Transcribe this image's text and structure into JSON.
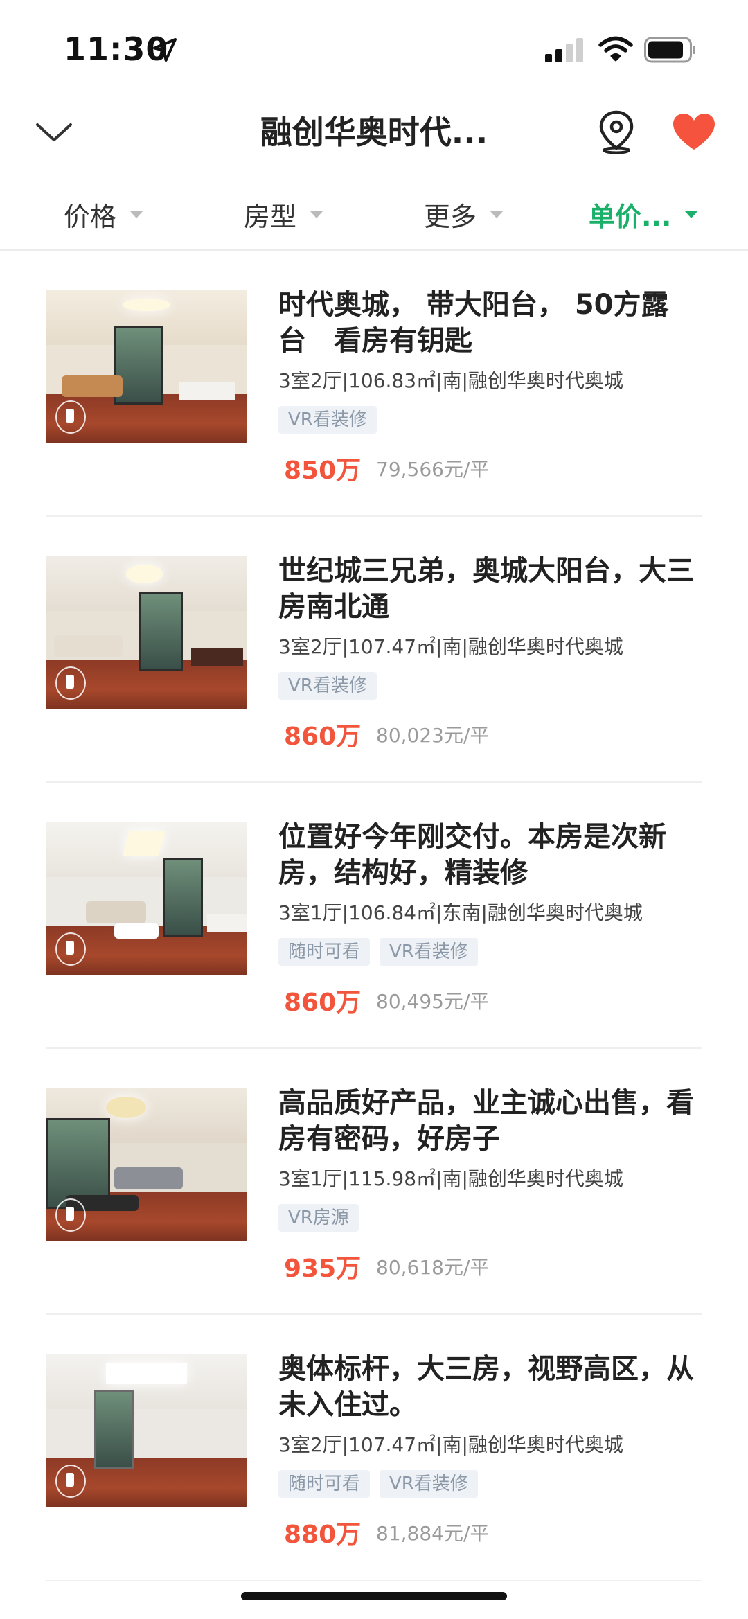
{
  "status_bar": {
    "time": "11:30"
  },
  "nav": {
    "title": "融创华奥时代..."
  },
  "filters": [
    {
      "label": "价格",
      "active": false
    },
    {
      "label": "房型",
      "active": false
    },
    {
      "label": "更多",
      "active": false
    },
    {
      "label": "单价...",
      "active": true
    }
  ],
  "listings": [
    {
      "title": "时代奥城， 带大阳台， 50方露台　看房有钥匙",
      "meta": "3室2厅|106.83㎡|南|融创华奥时代奥城",
      "tags": [
        "VR看装修"
      ],
      "price": "850万",
      "unit_price": "79,566元/平"
    },
    {
      "title": "世纪城三兄弟，奥城大阳台，大三房南北通",
      "meta": "3室2厅|107.47㎡|南|融创华奥时代奥城",
      "tags": [
        "VR看装修"
      ],
      "price": "860万",
      "unit_price": "80,023元/平"
    },
    {
      "title": "位置好今年刚交付。本房是次新房，结构好，精装修",
      "meta": "3室1厅|106.84㎡|东南|融创华奥时代奥城",
      "tags": [
        "随时可看",
        "VR看装修"
      ],
      "price": "860万",
      "unit_price": "80,495元/平"
    },
    {
      "title": "高品质好产品，业主诚心出售，看房有密码，好房子",
      "meta": "3室1厅|115.98㎡|南|融创华奥时代奥城",
      "tags": [
        "VR房源"
      ],
      "price": "935万",
      "unit_price": "80,618元/平"
    },
    {
      "title": "奥体标杆，大三房，视野高区，从未入住过。",
      "meta": "3室2厅|107.47㎡|南|融创华奥时代奥城",
      "tags": [
        "随时可看",
        "VR看装修"
      ],
      "price": "880万",
      "unit_price": "81,884元/平"
    }
  ],
  "colors": {
    "accent": "#1ab06a",
    "price": "#f2553b",
    "favorite": "#f5533d"
  }
}
